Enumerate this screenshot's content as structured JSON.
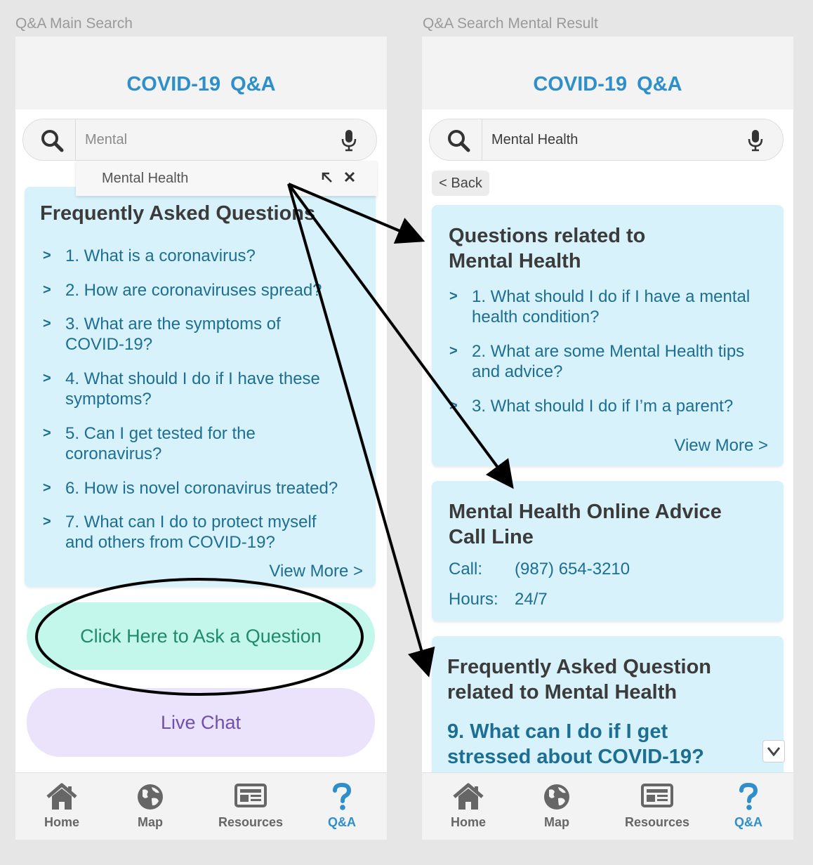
{
  "screens": {
    "left": {
      "frame_label": "Q&A Main Search",
      "header_title": "COVID-19  Q&A",
      "search_value": "Mental",
      "suggestion": "Mental Health",
      "faq": {
        "title": "Frequently Asked Questions",
        "items": [
          [
            "1. What is a coronavirus?"
          ],
          [
            "2. How are coronaviruses spread?"
          ],
          [
            "3. What are the symptoms of",
            "COVID-19?"
          ],
          [
            "4. What should I do if I have these",
            "symptoms?"
          ],
          [
            "5. Can I get tested for the",
            "coronavirus?"
          ],
          [
            "6. How is novel coronavirus treated?"
          ],
          [
            "7. What can I do to protect myself",
            "and others from COVID-19?"
          ]
        ],
        "view_more": "View More >"
      },
      "ask_button": "Click Here to Ask a Question",
      "live_chat_button": "Live Chat"
    },
    "right": {
      "frame_label": "Q&A Search Mental Result",
      "header_title": "COVID-19  Q&A",
      "search_value": "Mental Health",
      "back_button": "< Back",
      "related": {
        "title_line1": "Questions related to",
        "title_line2": "Mental Health",
        "items": [
          [
            "1. What should I do if I have a mental",
            "health condition?"
          ],
          [
            "2. What are some Mental Health tips",
            "and advice?"
          ],
          [
            "3. What should I do if I’m a parent?"
          ]
        ],
        "view_more": "View More >"
      },
      "callline": {
        "title_line1": "Mental Health Online Advice",
        "title_line2": "Call Line",
        "call_label": "Call:",
        "call_value": "(987) 654-3210",
        "hours_label": "Hours:",
        "hours_value": "24/7"
      },
      "faq_related": {
        "title_line1": "Frequently Asked Question",
        "title_line2": "related to Mental Health",
        "question_line1": "9. What can I do if I get",
        "question_line2": "stressed about COVID-19?"
      }
    }
  },
  "tabbar": {
    "items": [
      "Home",
      "Map",
      "Resources",
      "Q&A"
    ],
    "active": "Q&A"
  },
  "icons": {
    "search": "search-icon",
    "mic": "microphone-icon",
    "fill": "arrow-up-left-icon",
    "close": "close-icon",
    "chevron": ">",
    "home": "home-icon",
    "map": "globe-icon",
    "resources": "newspaper-icon",
    "qa": "question-mark-icon",
    "scroll": "chevron-down-icon"
  },
  "colors": {
    "brand_blue": "#2e8fcb",
    "card_bg": "#d8f2fb",
    "question_text": "#1d6e93",
    "ask_bg": "#c4f7ec",
    "ask_text": "#1f8a6c",
    "chat_bg": "#ebe3fb",
    "chat_text": "#6f4fb0"
  }
}
